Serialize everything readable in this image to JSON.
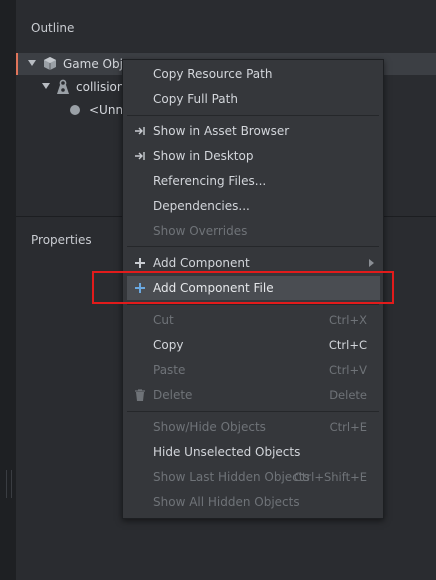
{
  "outline": {
    "title": "Outline",
    "tree": [
      {
        "label": "Game Obje",
        "icon": "cube-icon"
      },
      {
        "label": "collision",
        "icon": "collision-weight-icon"
      },
      {
        "label": "<Unna",
        "icon": "circle-icon"
      }
    ]
  },
  "properties": {
    "title": "Properties"
  },
  "context_menu": {
    "copy_resource_path": "Copy Resource Path",
    "copy_full_path": "Copy Full Path",
    "show_in_asset_browser": "Show in Asset Browser",
    "show_in_desktop": "Show in Desktop",
    "referencing_files": "Referencing Files...",
    "dependencies": "Dependencies...",
    "show_overrides": "Show Overrides",
    "add_component": "Add Component",
    "add_component_file": "Add Component File",
    "cut": {
      "label": "Cut",
      "shortcut": "Ctrl+X"
    },
    "copy": {
      "label": "Copy",
      "shortcut": "Ctrl+C"
    },
    "paste": {
      "label": "Paste",
      "shortcut": "Ctrl+V"
    },
    "delete": {
      "label": "Delete",
      "shortcut": "Delete"
    },
    "show_hide_objects": {
      "label": "Show/Hide Objects",
      "shortcut": "Ctrl+E"
    },
    "hide_unselected_objects": "Hide Unselected Objects",
    "show_last_hidden_objects": {
      "label": "Show Last Hidden Objects",
      "shortcut": "Ctrl+Shift+E"
    },
    "show_all_hidden_objects": "Show All Hidden Objects"
  },
  "colors": {
    "highlight_box": "#e21b1b",
    "plus_icon": "#6aa8e0",
    "selection_accent": "#e0745a"
  }
}
